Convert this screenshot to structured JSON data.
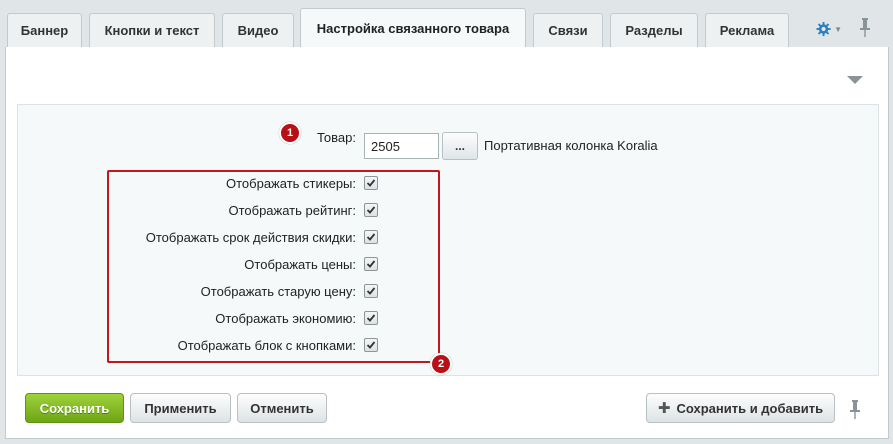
{
  "tabs": [
    {
      "label": "Баннер",
      "active": false
    },
    {
      "label": "Кнопки и текст",
      "active": false
    },
    {
      "label": "Видео",
      "active": false
    },
    {
      "label": "Настройка связанного товара",
      "active": true
    },
    {
      "label": "Связи",
      "active": false
    },
    {
      "label": "Разделы",
      "active": false
    },
    {
      "label": "Реклама",
      "active": false
    }
  ],
  "form": {
    "product_label": "Товар:",
    "product_value": "2505",
    "product_select_label": "...",
    "product_name": "Портативная колонка Koralia",
    "badges": [
      "1",
      "2"
    ],
    "options": [
      {
        "label": "Отображать стикеры:",
        "checked": true
      },
      {
        "label": "Отображать рейтинг:",
        "checked": true
      },
      {
        "label": "Отображать срок действия скидки:",
        "checked": true
      },
      {
        "label": "Отображать цены:",
        "checked": true
      },
      {
        "label": "Отображать старую цену:",
        "checked": true
      },
      {
        "label": "Отображать экономию:",
        "checked": true
      },
      {
        "label": "Отображать блок с кнопками:",
        "checked": true
      }
    ]
  },
  "footer": {
    "save_label": "Сохранить",
    "apply_label": "Применить",
    "cancel_label": "Отменить",
    "save_add_label": "Сохранить и добавить"
  },
  "colors": {
    "accent_red": "#c0181f",
    "save_green": "#7db51f",
    "gear_blue": "#2a80c0"
  },
  "icons": {
    "settings": "gear-icon",
    "pin": "pin-icon",
    "collapse": "triangle-down-icon",
    "add": "plus-icon",
    "check": "checkmark-icon"
  }
}
